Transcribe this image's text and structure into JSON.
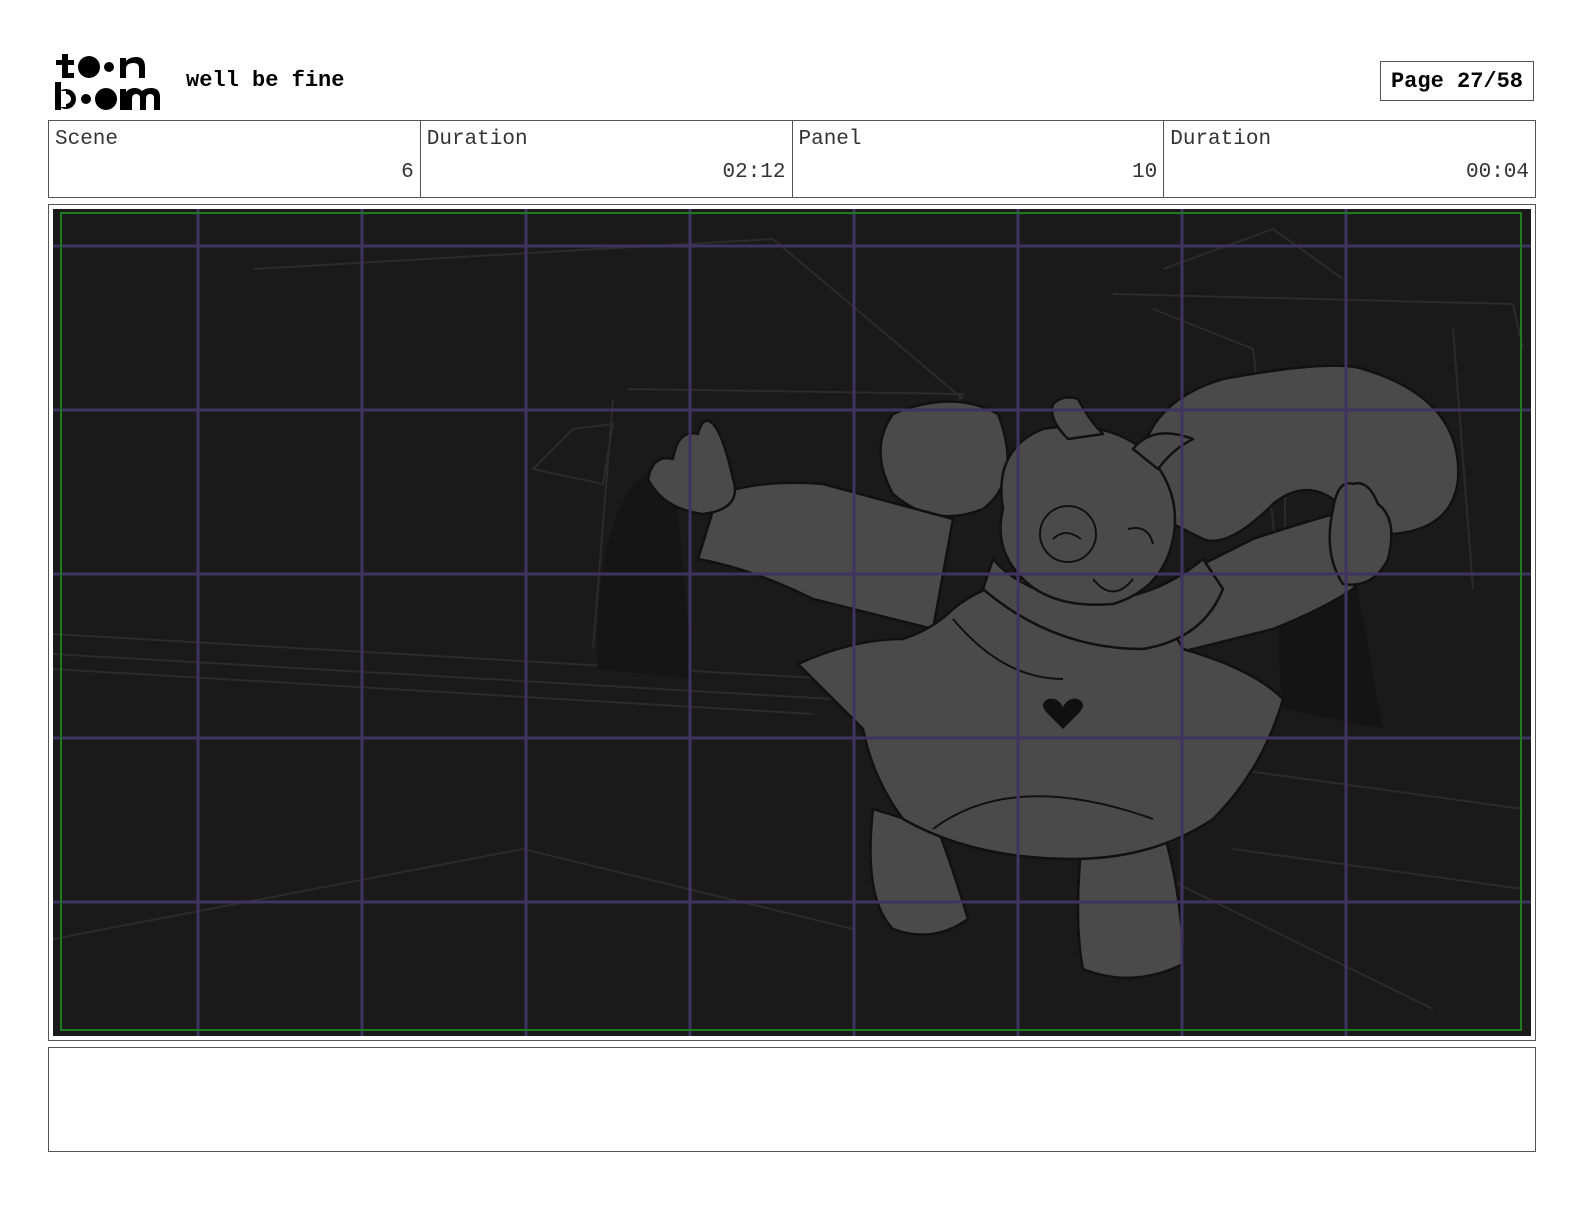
{
  "header": {
    "logo_text": "toonboom",
    "project_title": "well be fine",
    "page_label": "Page 27/58"
  },
  "info": {
    "scene_label": "Scene",
    "scene_value": "6",
    "scene_duration_label": "Duration",
    "scene_duration_value": "02:12",
    "panel_label": "Panel",
    "panel_value": "10",
    "panel_duration_label": "Duration",
    "panel_duration_value": "00:04"
  },
  "notes": {
    "text": ""
  },
  "colors": {
    "panel_background": "#1a1a1a",
    "grid_line": "#3d3463",
    "safe_frame": "#1f7a1f",
    "character_fill": "#4a4a4a"
  }
}
